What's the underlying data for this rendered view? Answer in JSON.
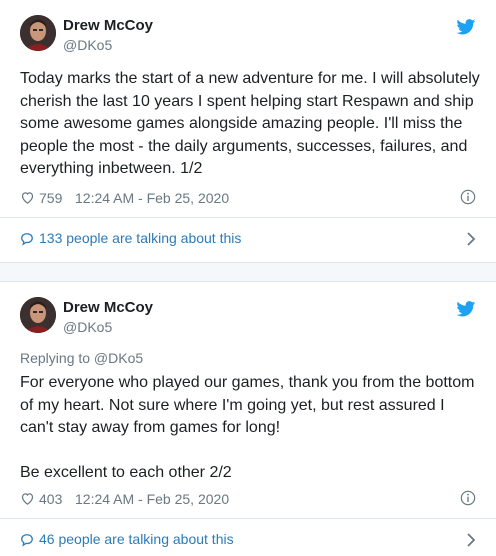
{
  "tweets": [
    {
      "author": {
        "name": "Drew McCoy",
        "handle": "@DKo5"
      },
      "reply_to": "",
      "text": "Today marks the start of a new adventure for me. I will absolutely cherish the last 10 years I spent helping start Respawn and ship some awesome games alongside amazing people. I'll miss the people the most - the daily arguments, successes, failures, and everything inbetween. 1/2",
      "likes": "759",
      "timestamp": "12:24 AM - Feb 25, 2020",
      "conversation": "133 people are talking about this"
    },
    {
      "author": {
        "name": "Drew McCoy",
        "handle": "@DKo5"
      },
      "reply_to": "Replying to @DKo5",
      "text": "For everyone who played our games, thank you from the bottom of my heart. Not sure where I'm going yet, but rest assured I can't stay away from games for long!\n\nBe excellent to each other 2/2",
      "likes": "403",
      "timestamp": "12:24 AM - Feb 25, 2020",
      "conversation": "46 people are talking about this"
    }
  ],
  "icons": {
    "brand": "twitter-bird-icon",
    "like": "heart-icon",
    "info": "info-icon",
    "conversation": "speech-bubble-icon",
    "more": "chevron-right-icon"
  },
  "colors": {
    "brand": "#1da1f2",
    "link": "#2b7bb9",
    "muted": "#697882",
    "text": "#1c2022",
    "border": "#e1e8ed"
  }
}
